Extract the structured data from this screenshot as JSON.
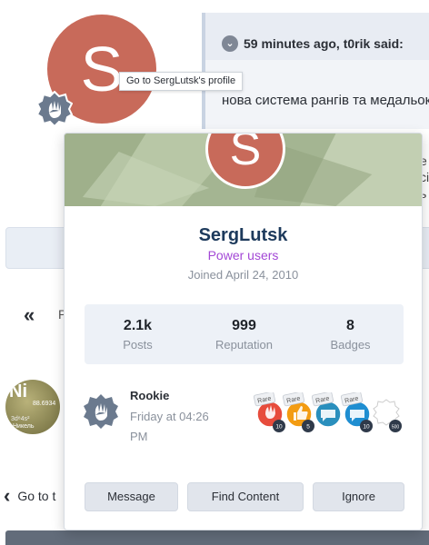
{
  "background": {
    "avatar_letter": "S",
    "quote": {
      "header": "59 minutes ago, t0rik said:",
      "text": "нова система рангів та медальок"
    },
    "side_fragment": [
      "е",
      "сі",
      "ь"
    ],
    "pagination_fragment": "Р",
    "element_avatar": {
      "symbol": "Ni",
      "number": "88.6934",
      "config": "3d⁸4s²",
      "name": "Никель"
    },
    "goto_label": "Go to t"
  },
  "tooltip": "Go to SergLutsk's profile",
  "card": {
    "avatar_letter": "S",
    "name": "SergLutsk",
    "group": "Power users",
    "joined": "Joined April 24, 2010",
    "stats": [
      {
        "value": "2.1k",
        "label": "Posts"
      },
      {
        "value": "999",
        "label": "Reputation"
      },
      {
        "value": "8",
        "label": "Badges"
      }
    ],
    "rank": {
      "title": "Rookie",
      "date": "Friday at 04:26 PM",
      "icon": "waving-hand-icon"
    },
    "badges": [
      {
        "tag": "Rare",
        "color": "#e74c3c",
        "count": "10",
        "icon": "hand-icon"
      },
      {
        "tag": "Rare",
        "color": "#f39c12",
        "count": "5",
        "icon": "thumbs-up-icon"
      },
      {
        "tag": "Rare",
        "color": "#2a8fbd",
        "count": "",
        "icon": "chat-icon"
      },
      {
        "tag": "Rare",
        "color": "#1f8ed1",
        "count": "10",
        "icon": "chat-icon"
      },
      {
        "tag": "",
        "color": "#ffffff",
        "count": "500",
        "icon": "seal-icon"
      }
    ],
    "buttons": {
      "message": "Message",
      "find_content": "Find Content",
      "ignore": "Ignore"
    }
  }
}
